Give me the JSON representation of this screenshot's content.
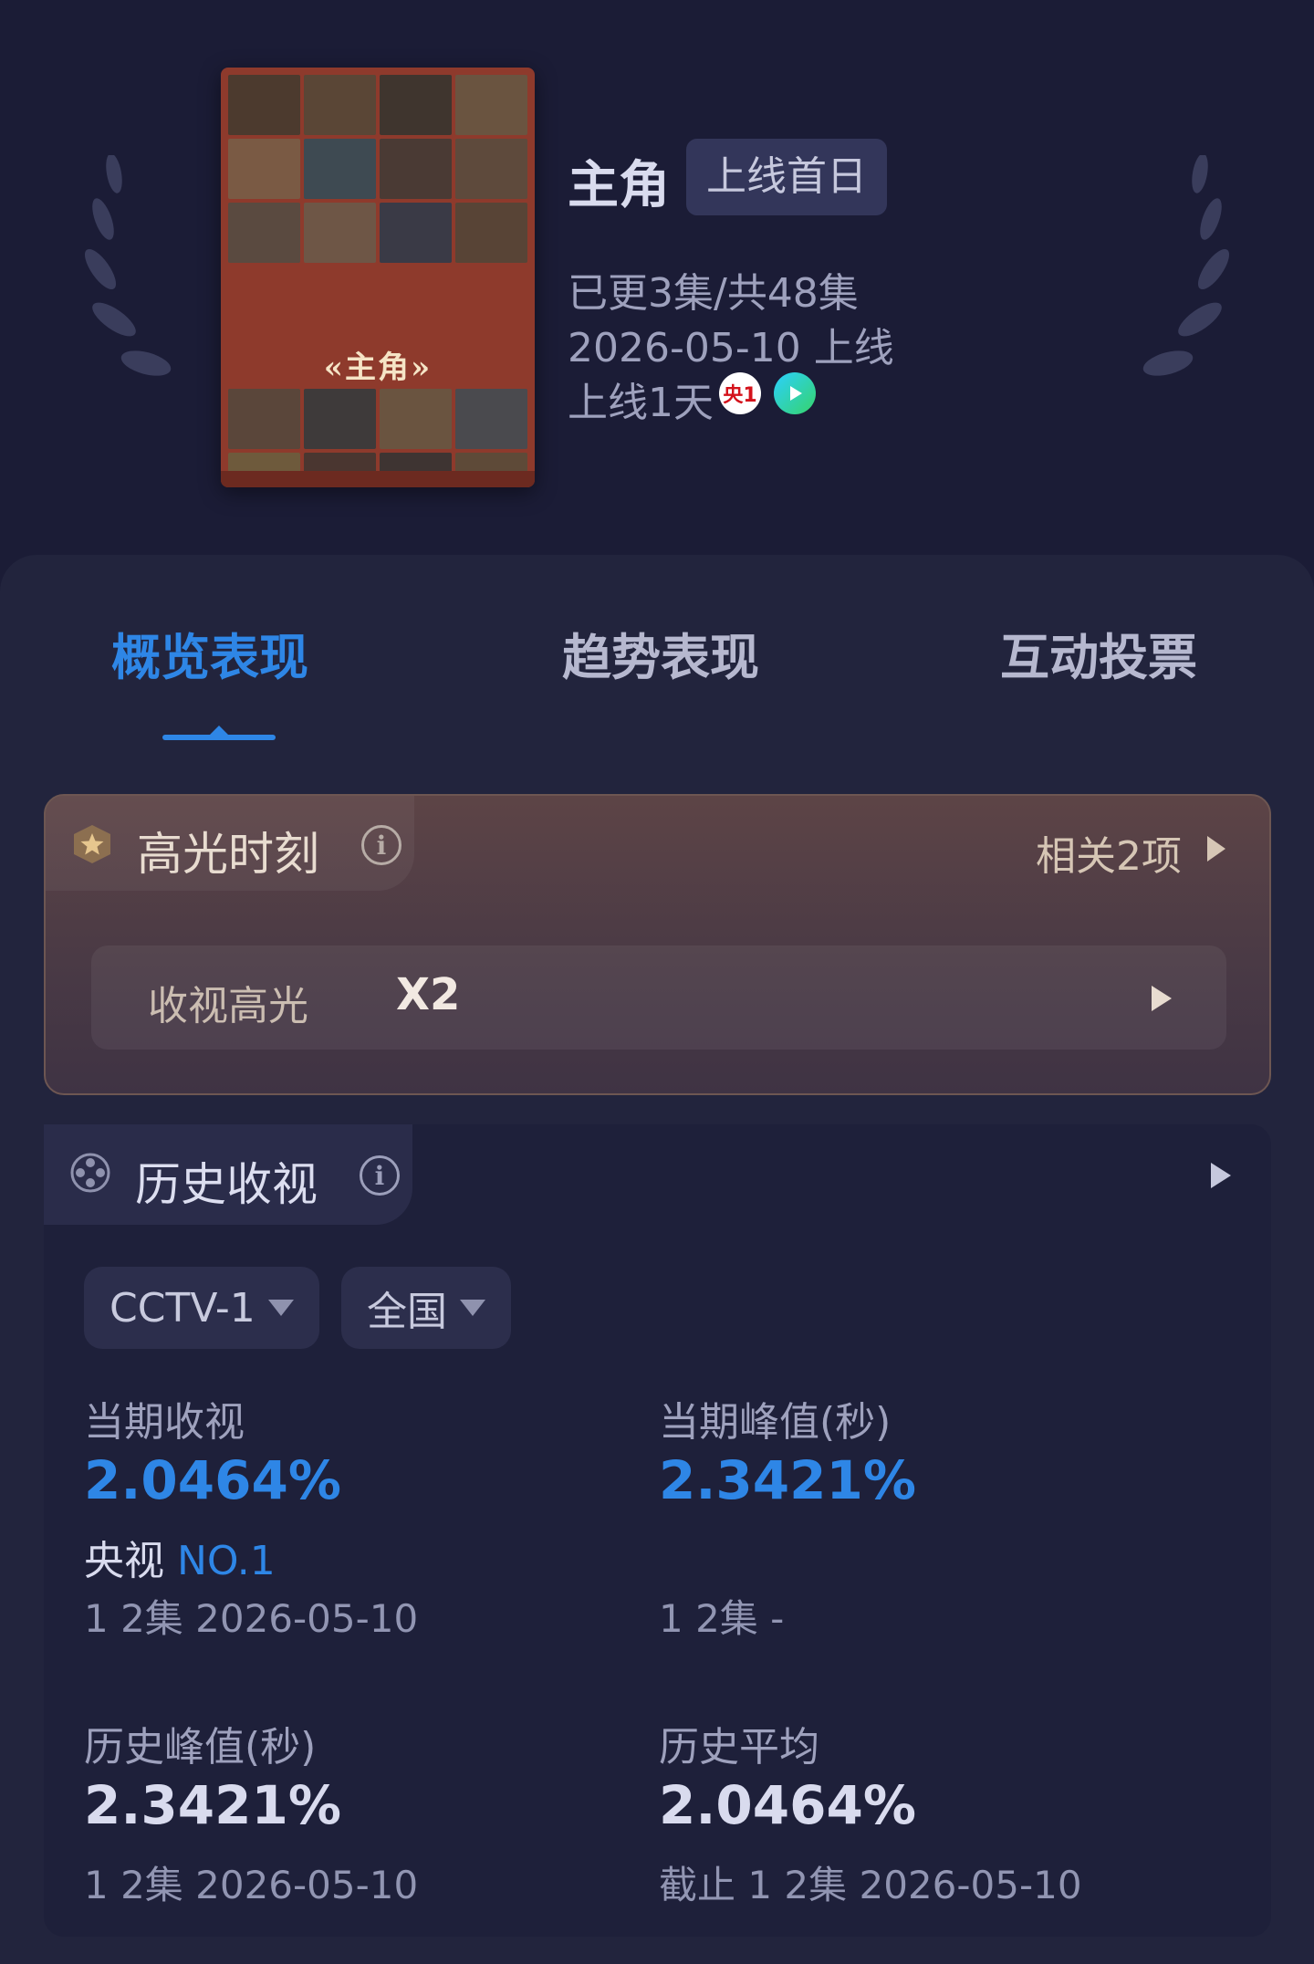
{
  "header": {
    "poster": {
      "title": "«主角»"
    },
    "show_name": "主角",
    "badge": "上线首日",
    "episodes": "已更3集/共48集",
    "release": "2026-05-10 上线",
    "online_days": "上线1天",
    "platform_logos": [
      "cctv1-logo",
      "video-play-logo"
    ],
    "cctv_logo_text": "央1"
  },
  "tabs": [
    {
      "label": "概览表现",
      "active": true
    },
    {
      "label": "趋势表现",
      "active": false
    },
    {
      "label": "互动投票",
      "active": false
    }
  ],
  "highlights": {
    "title": "高光时刻",
    "related": "相关2项",
    "row_label": "收视高光",
    "row_count": "X2"
  },
  "history": {
    "title": "历史收视",
    "channel": "CCTV-1",
    "region": "全国",
    "current_rating": {
      "label": "当期收视",
      "value": "2.0464%",
      "rank_prefix": "央视",
      "rank": "NO.1",
      "detail": "1 2集  2026-05-10"
    },
    "current_peak": {
      "label": "当期峰值(秒)",
      "value": "2.3421%",
      "detail": "1 2集  -"
    },
    "history_peak": {
      "label": "历史峰值(秒)",
      "value": "2.3421%",
      "detail": "1 2集  2026-05-10"
    },
    "history_avg": {
      "label": "历史平均",
      "value": "2.0464%",
      "detail": "截止 1 2集  2026-05-10"
    }
  },
  "colors": {
    "background": "#1b1c36",
    "accent_blue": "#2e86e6",
    "highlight_card": "#5d4446"
  }
}
